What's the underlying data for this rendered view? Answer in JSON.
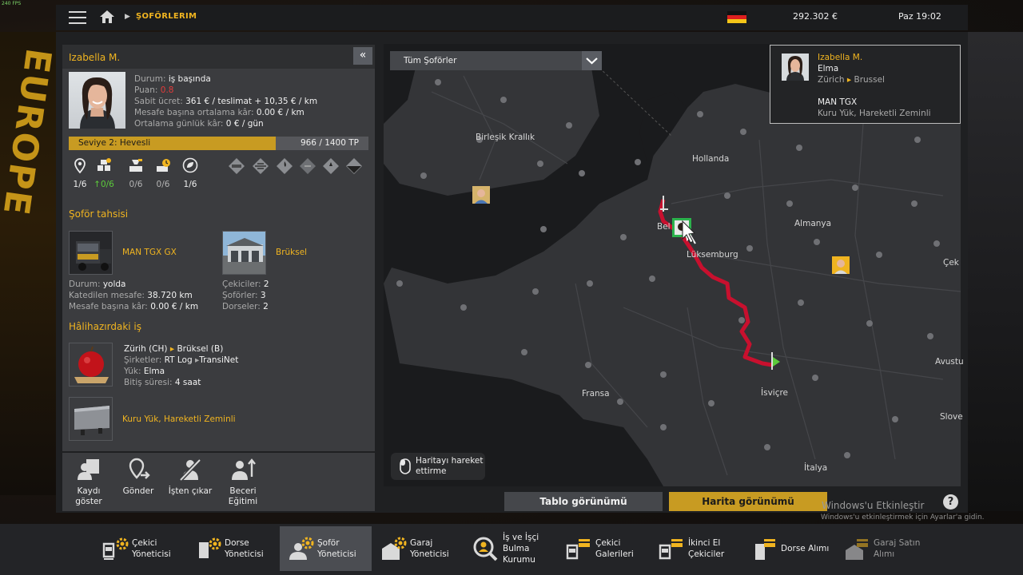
{
  "fps": "240 FPS",
  "topbar": {
    "breadcrumb": "ŞOFÖRLERIM",
    "money": "292.302 €",
    "clock": "Paz 19:02"
  },
  "background": {
    "sign": "EUROPE"
  },
  "driver": {
    "name": "Izabella M.",
    "status_label": "Durum:",
    "status": "iş başında",
    "rating_label": "Puan:",
    "rating": "0.8",
    "salary_label": "Sabit ücret:",
    "salary": "361 € / teslimat + 10,35 € / km",
    "profit_km_label": "Mesafe başına ortalama kâr:",
    "profit_km": "0.00 € / km",
    "profit_day_label": "Ortalama günlük kâr:",
    "profit_day": "0 € / gün",
    "level_label": "Seviye 2: Hevesli",
    "level_xp": "966 / 1400 TP",
    "level_fraction": 0.69,
    "skills": [
      {
        "icon": "adr-icon",
        "count": "1/6"
      },
      {
        "icon": "cargo-weight-icon",
        "prefix": "↑",
        "count": "0/6",
        "highlight": true
      },
      {
        "icon": "cargo-fragile-icon",
        "count": "0/6"
      },
      {
        "icon": "cargo-urgent-icon",
        "count": "0/6"
      },
      {
        "icon": "eco-driving-icon",
        "count": "1/6"
      }
    ]
  },
  "assignment": {
    "title": "Şoför tahsisi",
    "truck_name": "MAN TGX GX",
    "garage_name": "Brüksel",
    "truck_status_label": "Durum:",
    "truck_status": "yolda",
    "distance_label": "Katedilen mesafe:",
    "distance": "38.720 km",
    "profit_label": "Mesafe başına kâr:",
    "profit": "0.00 € / km",
    "trucks_label": "Çekiciler:",
    "trucks": "2",
    "drivers_label": "Şoförler:",
    "drivers": "3",
    "trailers_label": "Dorseler:",
    "trailers": "2"
  },
  "current_job": {
    "title": "Hâlihazırdaki iş",
    "from": "Zürih (CH)",
    "to": "Brüksel (B)",
    "companies_label": "Şirketler:",
    "company_from": "RT Log",
    "company_to": "TransiNet",
    "cargo_label": "Yük:",
    "cargo": "Elma",
    "time_label": "Bitiş süresi:",
    "time": "4 saat",
    "trailer": "Kuru Yük, Hareketli Zeminli"
  },
  "actions": [
    {
      "icon": "show-record-icon",
      "label1": "Kaydı",
      "label2": "göster"
    },
    {
      "icon": "send-icon",
      "label1": "Gönder",
      "label2": ""
    },
    {
      "icon": "fire-icon",
      "label1": "İşten çıkar",
      "label2": ""
    },
    {
      "icon": "skill-training-icon",
      "label1": "Beceri",
      "label2": "Eğitimi"
    }
  ],
  "map": {
    "filter": "Tüm Şoförler",
    "card": {
      "name": "Izabella M.",
      "cargo": "Elma",
      "from": "Zürich",
      "to": "Brussel",
      "truck": "MAN TGX",
      "trailer": "Kuru Yük, Hareketli Zeminli"
    },
    "labels": [
      "Birleşik Krallık",
      "Hollanda",
      "Bel",
      "Lüksemburg",
      "Almanya",
      "Çek",
      "Fransa",
      "İsviçre",
      "Avustu",
      "Slove",
      "İtalya"
    ],
    "move_hint1": "Haritayı hareket",
    "move_hint2": "ettirme"
  },
  "view_tabs": {
    "table": "Tablo görünümü",
    "map": "Harita görünümü",
    "active": "map"
  },
  "watermark": {
    "title": "Windows'u Etkinleştir",
    "sub": "Windows'u etkinleştirmek için Ayarlar'a gidin."
  },
  "nav": [
    {
      "icon": "truck-manager-icon",
      "label1": "Çekici",
      "label2": "Yöneticisi"
    },
    {
      "icon": "trailer-manager-icon",
      "label1": "Dorse",
      "label2": "Yöneticisi"
    },
    {
      "icon": "driver-manager-icon",
      "label1": "Şoför",
      "label2": "Yöneticisi",
      "active": true
    },
    {
      "icon": "garage-manager-icon",
      "label1": "Garaj",
      "label2": "Yöneticisi"
    },
    {
      "icon": "recruitment-icon",
      "label1": "İş ve İşçi",
      "label2": "Bulma",
      "label3": "Kurumu"
    },
    {
      "icon": "truck-dealer-icon",
      "label1": "Çekici",
      "label2": "Galerileri"
    },
    {
      "icon": "used-truck-icon",
      "label1": "İkinci El",
      "label2": "Çekiciler"
    },
    {
      "icon": "trailer-purchase-icon",
      "label1": "Dorse Alımı",
      "label2": ""
    },
    {
      "icon": "garage-purchase-icon",
      "label1": "Garaj Satın",
      "label2": "Alımı",
      "dim": true
    }
  ],
  "colors": {
    "accent": "#f0b420",
    "route": "#c8102e",
    "green": "#5ccb3b"
  }
}
